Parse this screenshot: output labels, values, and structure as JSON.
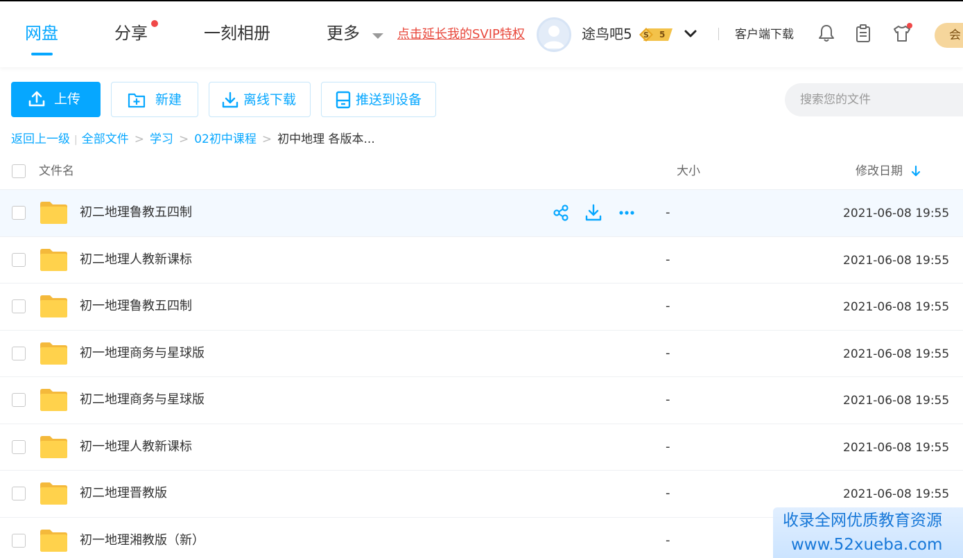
{
  "nav": {
    "tabs": [
      {
        "label": "网盘",
        "active": true
      },
      {
        "label": "分享",
        "has_dot": true
      },
      {
        "label": "一刻相册"
      },
      {
        "label": "更多"
      }
    ],
    "svip_link": "点击延长我的SVIP特权",
    "username": "途鸟吧5",
    "vip_level": "5",
    "client_download": "客户端下载",
    "member_button": "会",
    "icons": [
      "bell-icon",
      "clipboard-icon",
      "tshirt-icon"
    ]
  },
  "toolbar": {
    "upload_label": "上传",
    "new_label": "新建",
    "offline_download_label": "离线下载",
    "push_to_device_label": "推送到设备",
    "search_placeholder": "搜索您的文件"
  },
  "breadcrumb": {
    "back": "返回上一级",
    "items": [
      "全部文件",
      "学习",
      "02初中课程"
    ],
    "current": "初中地理 各版本..."
  },
  "table": {
    "columns": {
      "name": "文件名",
      "size": "大小",
      "modified": "修改日期"
    },
    "sort": {
      "column": "modified",
      "direction": "desc"
    },
    "rows": [
      {
        "name": "初二地理鲁教五四制",
        "size": "-",
        "modified": "2021-06-08 19:55",
        "hovered": true
      },
      {
        "name": "初二地理人教新课标",
        "size": "-",
        "modified": "2021-06-08 19:55"
      },
      {
        "name": "初一地理鲁教五四制",
        "size": "-",
        "modified": "2021-06-08 19:55"
      },
      {
        "name": "初一地理商务与星球版",
        "size": "-",
        "modified": "2021-06-08 19:55"
      },
      {
        "name": "初二地理商务与星球版",
        "size": "-",
        "modified": "2021-06-08 19:55"
      },
      {
        "name": "初一地理人教新课标",
        "size": "-",
        "modified": "2021-06-08 19:55"
      },
      {
        "name": "初二地理晋教版",
        "size": "-",
        "modified": "2021-06-08 19:55"
      },
      {
        "name": "初一地理湘教版（新）",
        "size": "-",
        "modified": ""
      }
    ],
    "row_actions": [
      "share-icon",
      "download-icon",
      "more-icon"
    ]
  },
  "watermark": {
    "line1": "收录全网优质教育资源",
    "line2": "www.52xueba.com"
  },
  "colors": {
    "accent": "#06a7ff",
    "svip_link": "#e8483c",
    "folder": "#ffd24c",
    "hover_row": "#f3f9ff"
  }
}
